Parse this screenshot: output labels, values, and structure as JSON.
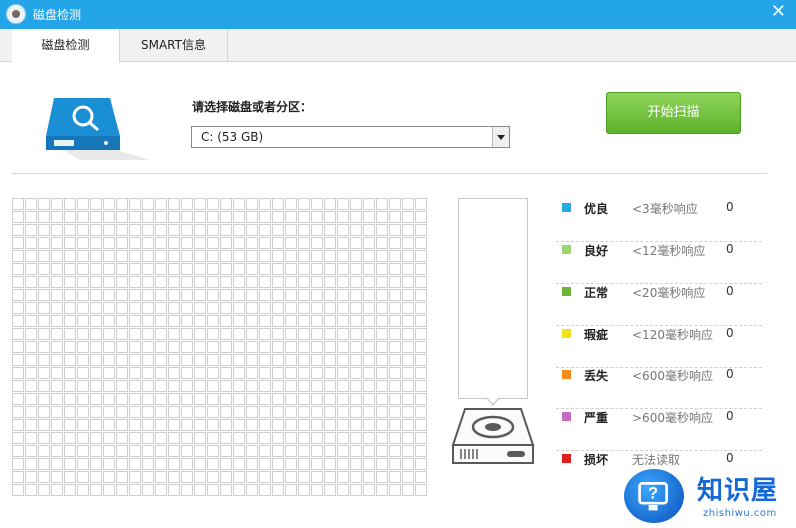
{
  "window": {
    "title": "磁盘检测",
    "close_glyph": "✕"
  },
  "tabs": [
    {
      "label": "磁盘检测",
      "active": true
    },
    {
      "label": "SMART信息",
      "active": false
    }
  ],
  "select": {
    "label": "请选择磁盘或者分区：",
    "value": "C:  (53 GB)"
  },
  "start_button": {
    "label": "开始扫描"
  },
  "legend": [
    {
      "name": "优良",
      "desc": "<3毫秒响应",
      "count": "0",
      "color": "#29abe2"
    },
    {
      "name": "良好",
      "desc": "<12毫秒响应",
      "count": "0",
      "color": "#9ad56c"
    },
    {
      "name": "正常",
      "desc": "<20毫秒响应",
      "count": "0",
      "color": "#6fb33a"
    },
    {
      "name": "瑕疵",
      "desc": "<120毫秒响应",
      "count": "0",
      "color": "#f2e21a"
    },
    {
      "name": "丢失",
      "desc": "<600毫秒响应",
      "count": "0",
      "color": "#f58a1f"
    },
    {
      "name": "严重",
      "desc": ">600毫秒响应",
      "count": "0",
      "color": "#c46bc2"
    },
    {
      "name": "损坏",
      "desc": "无法读取",
      "count": "0",
      "color": "#e02020"
    }
  ],
  "watermark": {
    "title": "知识屋",
    "subtitle": "zhishiwu.com"
  },
  "colors": {
    "titlebar": "#24a5e8",
    "accent_button": "#6dbe3a",
    "grid_border": "#cfcfcf"
  },
  "icons": {
    "app": "app-avatar-icon",
    "disk": "disk-search-icon",
    "hdd": "hard-drive-icon",
    "close": "close-icon"
  }
}
